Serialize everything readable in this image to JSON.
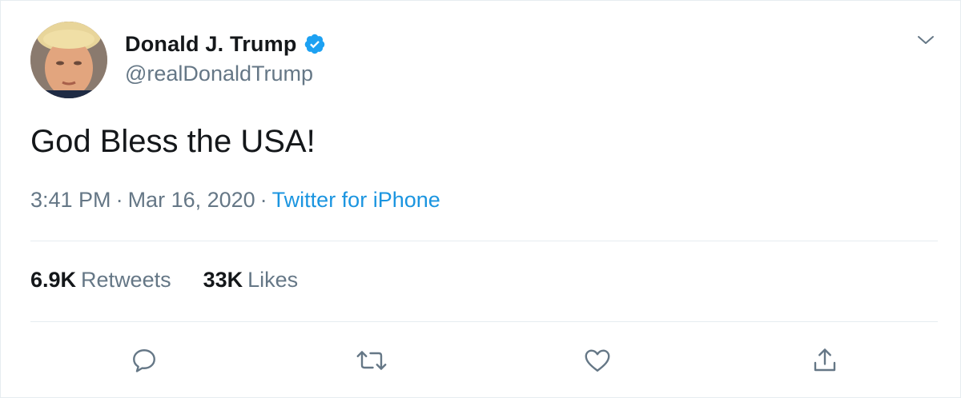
{
  "author": {
    "display_name": "Donald J. Trump",
    "handle": "@realDonaldTrump",
    "verified": true
  },
  "tweet": {
    "text": "God Bless the USA!",
    "time": "3:41 PM",
    "date": "Mar 16, 2020",
    "separator": "·",
    "source": "Twitter for iPhone"
  },
  "stats": {
    "retweets_count": "6.9K",
    "retweets_label": "Retweets",
    "likes_count": "33K",
    "likes_label": "Likes"
  },
  "icons": {
    "verified": "verified-badge-icon",
    "caret": "chevron-down-icon",
    "reply": "reply-icon",
    "retweet": "retweet-icon",
    "like": "heart-icon",
    "share": "share-icon"
  },
  "colors": {
    "accent": "#1da1f2",
    "link": "#1b95e0",
    "muted": "#657786",
    "text": "#14171a",
    "border": "#e6ecf0"
  }
}
